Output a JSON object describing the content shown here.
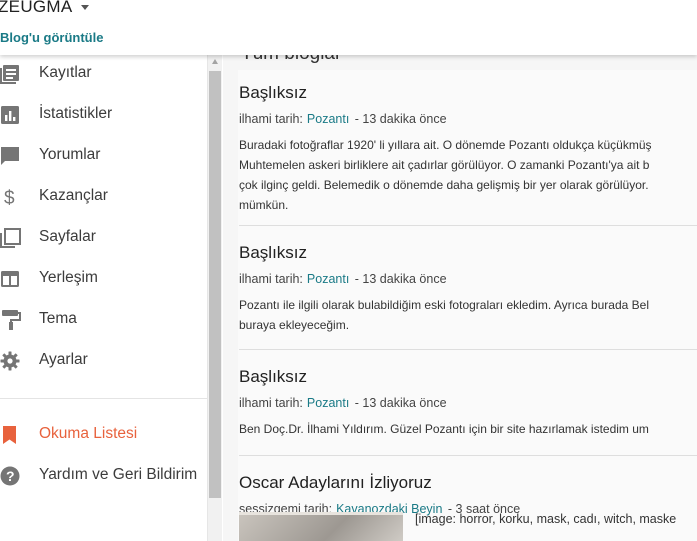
{
  "header": {
    "blog_name": "ZEUGMA",
    "view_blog": "Blog'u görüntüle"
  },
  "sidebar": {
    "items": [
      {
        "label": "Kayıtlar",
        "icon": "posts-icon"
      },
      {
        "label": "İstatistikler",
        "icon": "stats-icon"
      },
      {
        "label": "Yorumlar",
        "icon": "comments-icon"
      },
      {
        "label": "Kazançlar",
        "icon": "dollar-icon"
      },
      {
        "label": "Sayfalar",
        "icon": "pages-icon"
      },
      {
        "label": "Yerleşim",
        "icon": "layout-icon"
      },
      {
        "label": "Tema",
        "icon": "paint-roller-icon"
      },
      {
        "label": "Ayarlar",
        "icon": "gear-icon"
      }
    ],
    "secondary": [
      {
        "label": "Okuma Listesi",
        "icon": "bookmark-icon",
        "color": "#e8623d"
      },
      {
        "label": "Yardım ve Geri Bildirim",
        "icon": "help-icon"
      }
    ]
  },
  "main": {
    "title": "Tüm bloglar",
    "posts": [
      {
        "title": "Başlıksız",
        "author_prefix": "ilhami tarih:",
        "blog": "Pozantı",
        "time": "- 13 dakika önce",
        "lines": [
          "Buradaki fotoğraflar 1920' li yıllara ait. O dönemde Pozantı oldukça küçükmüş",
          "Muhtemelen askeri birliklere ait çadırlar görülüyor. O zamanki Pozantı'ya ait b",
          "çok ilginç geldi. Belemedik o dönemde daha gelişmiş bir yer olarak görülüyor.",
          "mümkün."
        ]
      },
      {
        "title": "Başlıksız",
        "author_prefix": "ilhami tarih:",
        "blog": "Pozantı",
        "time": "- 13 dakika önce",
        "lines": [
          "Pozantı ile ilgili olarak bulabildiğim eski fotograları ekledim. Ayrıca burada Bel",
          "buraya ekleyeceğim."
        ]
      },
      {
        "title": "Başlıksız",
        "author_prefix": "ilhami tarih:",
        "blog": "Pozantı",
        "time": "- 13 dakika önce",
        "lines": [
          "Ben Doç.Dr. İlhami Yıldırım. Güzel Pozantı için bir site hazırlamak istedim um"
        ]
      },
      {
        "title": "Oscar Adaylarını İzliyoruz",
        "author_prefix": "sessizgemi tarih:",
        "blog": "Kavanozdaki Beyin",
        "time": "- 3 saat önce",
        "snippet": "[image: horror, korku, mask, cadı, witch, maske"
      }
    ]
  },
  "colors": {
    "accent": "#1a7a86",
    "reading_list": "#e8623d"
  }
}
